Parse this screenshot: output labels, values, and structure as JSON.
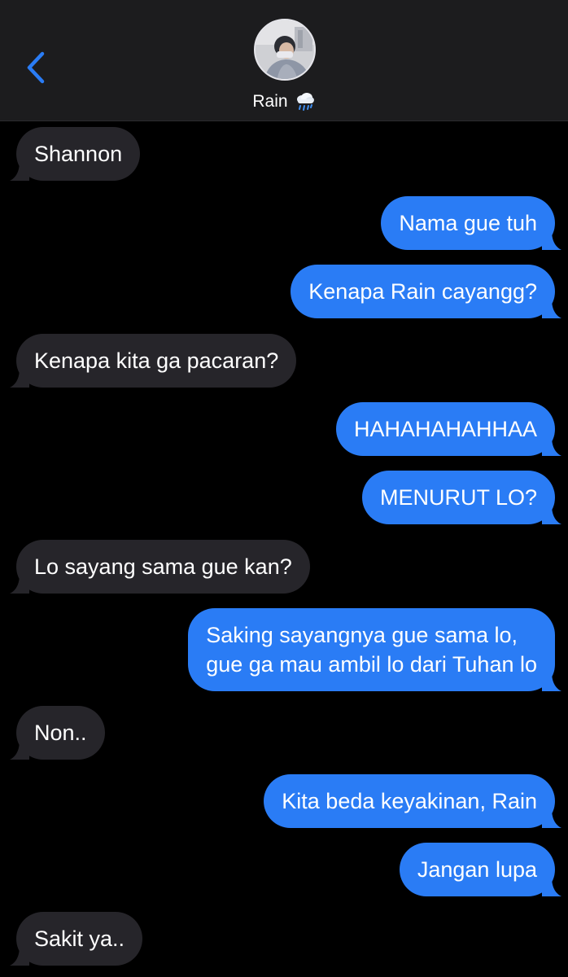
{
  "header": {
    "back_icon": "chevron-left-icon",
    "contact_name": "Rain",
    "contact_emoji": "cloud-with-rain-icon",
    "accent_color": "#2a7cf5"
  },
  "colors": {
    "incoming_bubble": "#26252a",
    "outgoing_bubble": "#2a7cf5",
    "background": "#000000"
  },
  "messages": [
    {
      "direction": "in",
      "text": "Shannon"
    },
    {
      "direction": "out",
      "text": "Nama gue tuh"
    },
    {
      "direction": "out",
      "text": "Kenapa Rain cayangg?"
    },
    {
      "direction": "in",
      "text": "Kenapa kita ga pacaran?"
    },
    {
      "direction": "out",
      "text": "HAHAHAHAHHAA"
    },
    {
      "direction": "out",
      "text": "MENURUT LO?"
    },
    {
      "direction": "in",
      "text": "Lo sayang sama gue kan?"
    },
    {
      "direction": "out",
      "line1": "Saking sayangnya gue sama lo,",
      "line2": "gue ga mau ambil lo dari Tuhan lo"
    },
    {
      "direction": "in",
      "text": "Non.."
    },
    {
      "direction": "out",
      "text": "Kita beda keyakinan, Rain"
    },
    {
      "direction": "out",
      "text": "Jangan lupa"
    },
    {
      "direction": "in",
      "text": "Sakit ya.."
    }
  ]
}
